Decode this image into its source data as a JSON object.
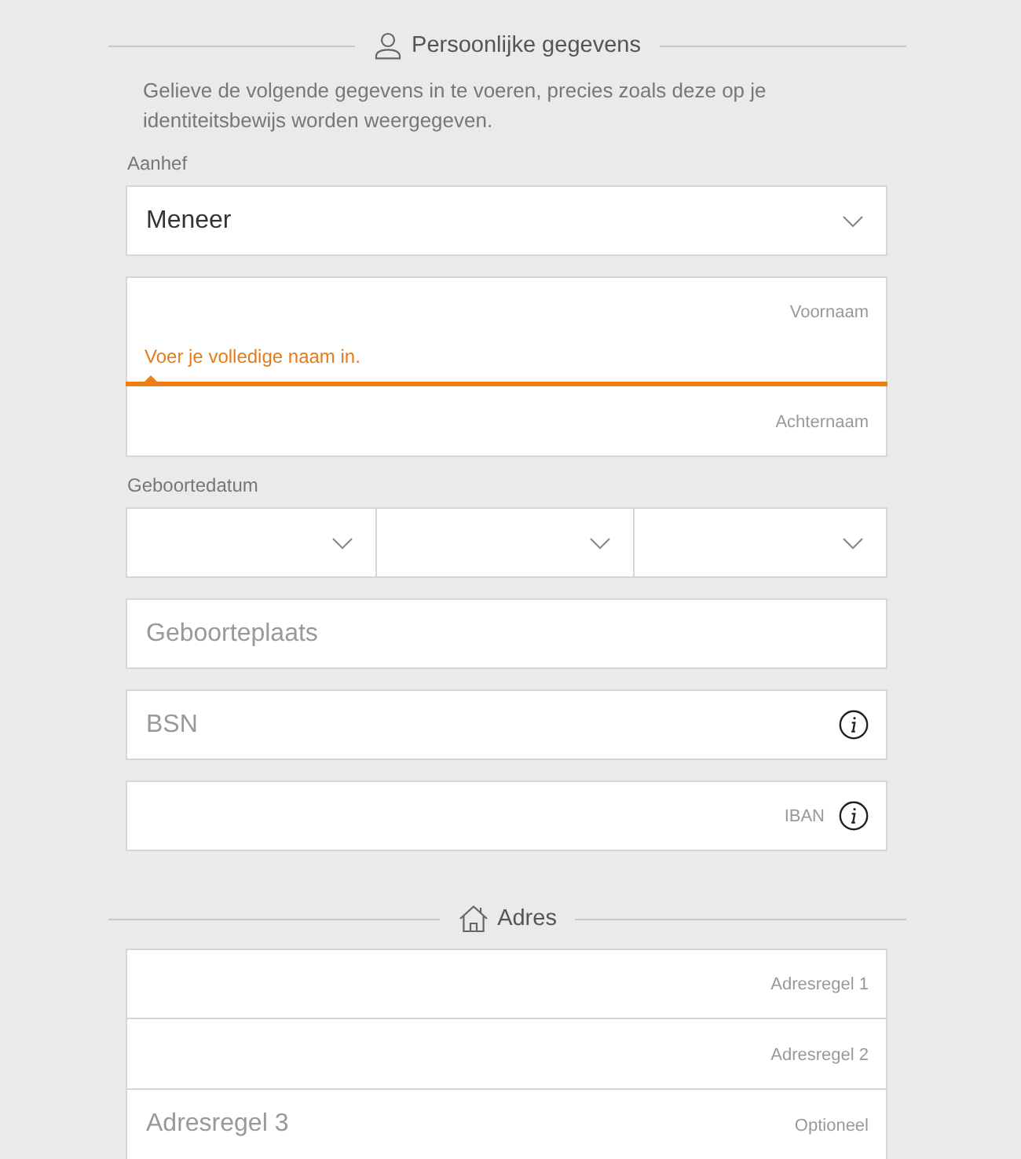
{
  "personal": {
    "title": "Persoonlijke gegevens",
    "intro": "Gelieve de volgende gegevens in te voeren, precies zoals deze op je identiteitsbewijs worden weergegeven.",
    "fields": [
      {
        "kind": "select",
        "label": "Aanhef",
        "value": "Meneer"
      },
      {
        "kind": "group",
        "rows": [
          {
            "side_label": "Voornaam",
            "error": "Voer je volledige naam in."
          },
          {
            "side_label": "Achternaam"
          }
        ]
      },
      {
        "kind": "date",
        "label": "Geboortedatum"
      },
      {
        "kind": "input",
        "placeholder": "Geboorteplaats"
      },
      {
        "kind": "input",
        "placeholder": "BSN",
        "info": true
      },
      {
        "kind": "input",
        "side_label": "IBAN",
        "info": true
      }
    ]
  },
  "address": {
    "title": "Adres",
    "fields": [
      {
        "kind": "group",
        "rows": [
          {
            "side_label": "Adresregel 1"
          },
          {
            "side_label": "Adresregel 2"
          },
          {
            "placeholder": "Adresregel 3",
            "side_label": "Optioneel"
          }
        ]
      }
    ]
  }
}
